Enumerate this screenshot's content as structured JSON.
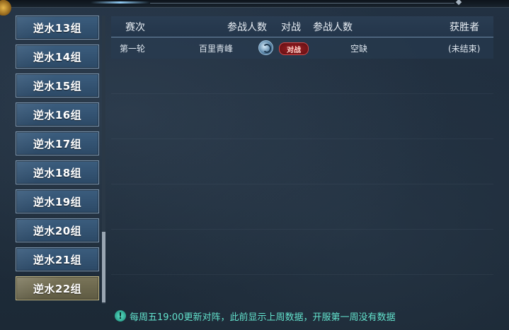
{
  "sidebar": {
    "groups": [
      {
        "label": "逆水13组",
        "active": false
      },
      {
        "label": "逆水14组",
        "active": false
      },
      {
        "label": "逆水15组",
        "active": false
      },
      {
        "label": "逆水16组",
        "active": false
      },
      {
        "label": "逆水17组",
        "active": false
      },
      {
        "label": "逆水18组",
        "active": false
      },
      {
        "label": "逆水19组",
        "active": false
      },
      {
        "label": "逆水20组",
        "active": false
      },
      {
        "label": "逆水21组",
        "active": false
      },
      {
        "label": "逆水22组",
        "active": true
      }
    ]
  },
  "table": {
    "headers": {
      "round": "赛次",
      "participants_a": "参战人数",
      "versus": "对战",
      "participants_b": "参战人数",
      "winner": "获胜者"
    },
    "rows": [
      {
        "round": "第一轮",
        "team_a": "百里青峰",
        "versus_label": "对战",
        "team_b": "空缺",
        "winner": "(未结束)"
      }
    ]
  },
  "notice": {
    "icon": "info-diamond-icon",
    "text": "每周五19:00更新对阵，此前显示上周数据，开服第一周没有数据"
  },
  "colors": {
    "accent": "#63e3cd",
    "active_group": "#6e6a4f",
    "group": "#34536f",
    "badge": "#8e1a1f"
  }
}
